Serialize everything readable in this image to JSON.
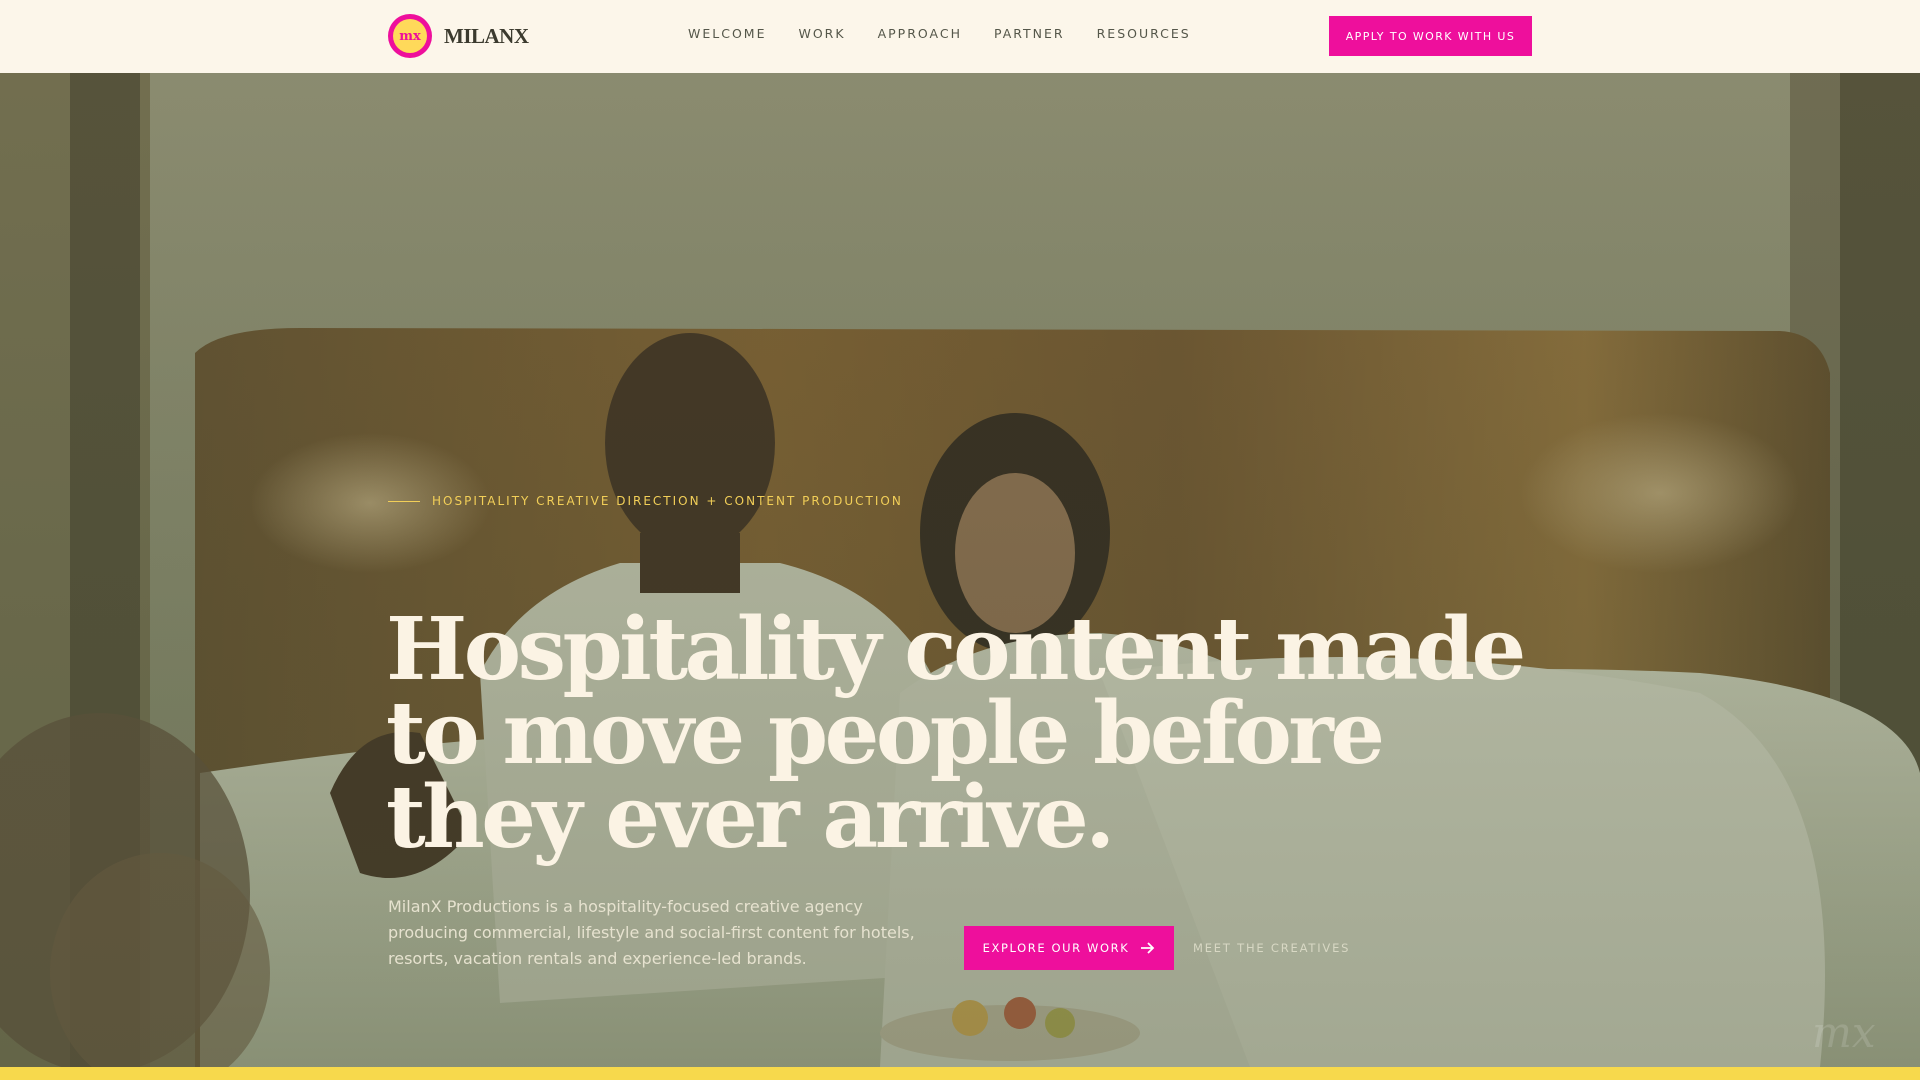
{
  "header": {
    "logo_mark_text": "mx",
    "logo_text": "MILANX",
    "nav": [
      "WELCOME",
      "WORK",
      "APPROACH",
      "PARTNER",
      "RESOURCES"
    ],
    "apply_label": "APPLY TO WORK WITH US"
  },
  "hero": {
    "eyebrow": "HOSPITALITY CREATIVE DIRECTION + CONTENT PRODUCTION",
    "headline": "Hospitality content made to move people before they ever arrive.",
    "subtext": "MilanX Productions is a hospitality-focused creative agency producing commercial, lifestyle and social-first content for hotels, resorts, vacation rentals and experience-led brands.",
    "explore_label": "EXPLORE OUR WORK",
    "meet_label": "MEET THE CREATIVES",
    "watermark": "mx"
  },
  "colors": {
    "accent": "#ee0f9c",
    "gold": "#f2cf58",
    "cream": "#fcf6ea",
    "bottom_bar": "#f7d94c"
  },
  "icons": [
    "logo-mark-icon",
    "arrow-right-icon"
  ]
}
